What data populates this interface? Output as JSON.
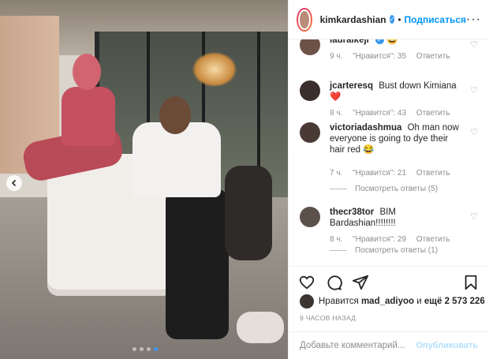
{
  "header": {
    "username": "kimkardashian",
    "separator": "•",
    "follow_label": "Подписаться",
    "more_label": "···"
  },
  "comments": [
    {
      "username": "lauraikeji",
      "text": "😀",
      "time": "9 ч.",
      "likes": "\"Нравится\": 35",
      "reply": "Ответить",
      "verified": true
    },
    {
      "username": "jcarteresq",
      "text": "Bust down Kimiana ❤️",
      "time": "8 ч.",
      "likes": "\"Нравится\": 43",
      "reply": "Ответить"
    },
    {
      "username": "victoriadashmua",
      "text": "Oh man now everyone is going to dye their hair red 😂",
      "time": "7 ч.",
      "likes": "\"Нравится\": 21",
      "reply": "Ответить",
      "view_replies": "Посмотреть ответы (5)"
    },
    {
      "username": "thecr38tor",
      "text": "BIM Bardashian!!!!!!!!",
      "time": "8 ч.",
      "likes": "\"Нравится\": 29",
      "reply": "Ответить",
      "view_replies": "Посмотреть ответы (1)"
    }
  ],
  "likes": {
    "prefix": "Нравится",
    "user": "mad_adiyoo",
    "conjunction": "и",
    "count": "ещё 2 573 226"
  },
  "timestamp": "9 ЧАСОВ НАЗАД",
  "add_comment": {
    "placeholder": "Добавьте комментарий...",
    "post_label": "Опубликовать"
  },
  "carousel": {
    "count": 4,
    "active_index": 3
  },
  "colors": {
    "accent": "#0095f6",
    "verified": "#3897f0",
    "muted": "#8e8e8e"
  }
}
